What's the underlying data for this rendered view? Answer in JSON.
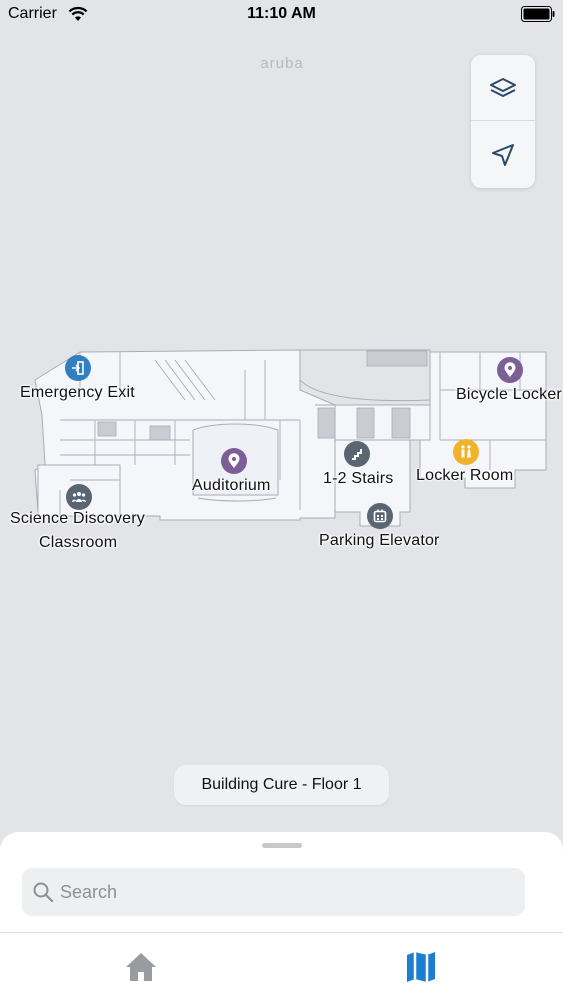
{
  "status_bar": {
    "carrier": "Carrier",
    "time": "11:10 AM"
  },
  "map": {
    "brand": "aruba",
    "controls": {
      "layers_icon": "layers-icon",
      "locate_icon": "location-arrow-icon"
    },
    "floor_label": "Building Cure - Floor 1",
    "pois": [
      {
        "id": "emergency-exit",
        "label": "Emergency Exit",
        "icon": "exit-icon",
        "color": "#2f7fc1"
      },
      {
        "id": "bicycle-locker",
        "label": "Bicycle Locker",
        "icon": "pin-icon",
        "color": "#7b5f95"
      },
      {
        "id": "auditorium",
        "label": "Auditorium",
        "icon": "pin-icon",
        "color": "#7b5f95"
      },
      {
        "id": "stairs",
        "label": "1-2 Stairs",
        "icon": "stairs-icon",
        "color": "#5a6573"
      },
      {
        "id": "locker-room",
        "label": "Locker Room",
        "icon": "restroom-icon",
        "color": "#f0b32b"
      },
      {
        "id": "science-classroom",
        "label_line1": "Science Discovery",
        "label_line2": "Classroom",
        "icon": "group-icon",
        "color": "#5a6573"
      },
      {
        "id": "parking-elevator",
        "label": "Parking Elevator",
        "icon": "elevator-icon",
        "color": "#5a6573"
      }
    ]
  },
  "sheet": {
    "search_placeholder": "Search"
  },
  "tabs": {
    "home_icon": "home-icon",
    "map_icon": "map-icon",
    "active_color": "#1a7fd1",
    "inactive_color": "#9a9ba0"
  }
}
